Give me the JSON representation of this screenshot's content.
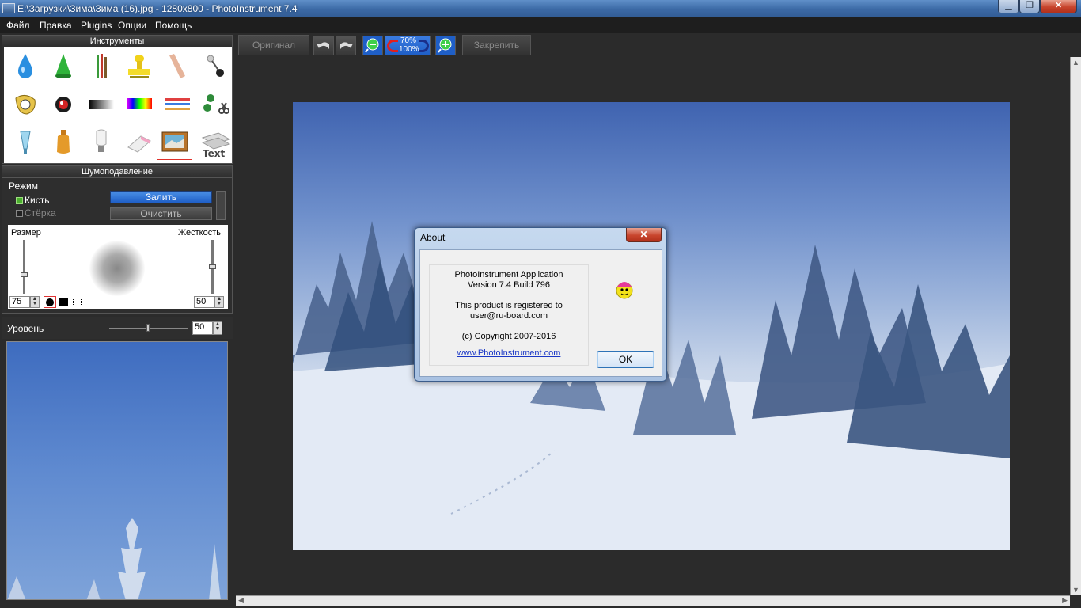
{
  "window": {
    "title": "E:\\Загрузки\\Зима\\Зима (16).jpg - 1280x800 - PhotoInstrument 7.4",
    "min_glyph": "▁",
    "max_glyph": "❐",
    "close_glyph": "✕"
  },
  "menu": [
    "Файл",
    "Правка",
    "Plugins",
    "Опции",
    "Помощь"
  ],
  "tools_panel": {
    "title": "Инструменты",
    "selected_tool": "noise-reduction-tool"
  },
  "denoise_panel": {
    "title": "Шумоподавление",
    "mode_label": "Режим",
    "brush_label": "Кисть",
    "eraser_label": "Стёрка",
    "fill_button": "Залить",
    "clear_button": "Очистить",
    "size_label": "Размер",
    "hardness_label": "Жесткость",
    "size_value": "75",
    "hardness_value": "50",
    "level_label": "Уровень",
    "level_value": "50"
  },
  "toolbar": {
    "original_button": "Оригинал",
    "zoom_top": "70%",
    "zoom_bottom": "100%",
    "pin_button": "Закрепить"
  },
  "about": {
    "title": "About",
    "close_glyph": "✕",
    "app_name": "PhotoInstrument Application",
    "version": "Version 7.4 Build 796",
    "registered_line1": "This product is registered to",
    "registered_line2": "user@ru-board.com",
    "copyright": "(c) Copyright 2007-2016",
    "website": "www.PhotoInstrument.com",
    "ok_button": "OK"
  },
  "colors": {
    "accent_blue": "#1f5fc7",
    "selection_red": "#e0302a",
    "background": "#2b2b2b"
  }
}
